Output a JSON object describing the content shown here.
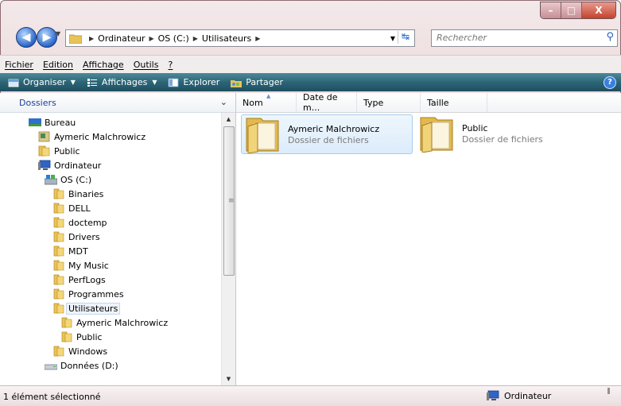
{
  "window": {
    "buttons": {
      "minimize": "–",
      "maximize": "□",
      "close": "X"
    }
  },
  "address": {
    "crumbs": [
      "Ordinateur",
      "OS (C:)",
      "Utilisateurs"
    ],
    "search_placeholder": "Rechercher"
  },
  "menu": [
    "Fichier",
    "Edition",
    "Affichage",
    "Outils",
    "?"
  ],
  "toolbar": {
    "organiser": "Organiser",
    "affichages": "Affichages",
    "explorer": "Explorer",
    "partager": "Partager",
    "help": "?"
  },
  "left": {
    "title": "Dossiers",
    "tree": [
      {
        "label": "Bureau",
        "icon": "desktop-icon"
      },
      {
        "label": "Aymeric Malchrowicz",
        "icon": "user-folder-icon"
      },
      {
        "label": "Public",
        "icon": "folder-icon"
      },
      {
        "label": "Ordinateur",
        "icon": "computer-icon"
      },
      {
        "label": "OS (C:)",
        "icon": "drive-icon"
      },
      {
        "label": "Binaries",
        "icon": "folder-icon"
      },
      {
        "label": "DELL",
        "icon": "folder-icon"
      },
      {
        "label": "doctemp",
        "icon": "folder-icon"
      },
      {
        "label": "Drivers",
        "icon": "folder-icon"
      },
      {
        "label": "MDT",
        "icon": "folder-icon"
      },
      {
        "label": "My Music",
        "icon": "folder-icon"
      },
      {
        "label": "PerfLogs",
        "icon": "folder-icon"
      },
      {
        "label": "Programmes",
        "icon": "folder-icon"
      },
      {
        "label": "Utilisateurs",
        "icon": "folder-icon"
      },
      {
        "label": "Aymeric Malchrowicz",
        "icon": "folder-icon"
      },
      {
        "label": "Public",
        "icon": "folder-icon"
      },
      {
        "label": "Windows",
        "icon": "folder-icon"
      },
      {
        "label": "Données (D:)",
        "icon": "drive-icon"
      }
    ]
  },
  "columns": [
    "Nom",
    "Date de m...",
    "Type",
    "Taille"
  ],
  "items": [
    {
      "name": "Aymeric Malchrowicz",
      "type": "Dossier de fichiers"
    },
    {
      "name": "Public",
      "type": "Dossier de fichiers"
    }
  ],
  "status": {
    "left": "1 élément sélectionné",
    "right": "Ordinateur"
  }
}
